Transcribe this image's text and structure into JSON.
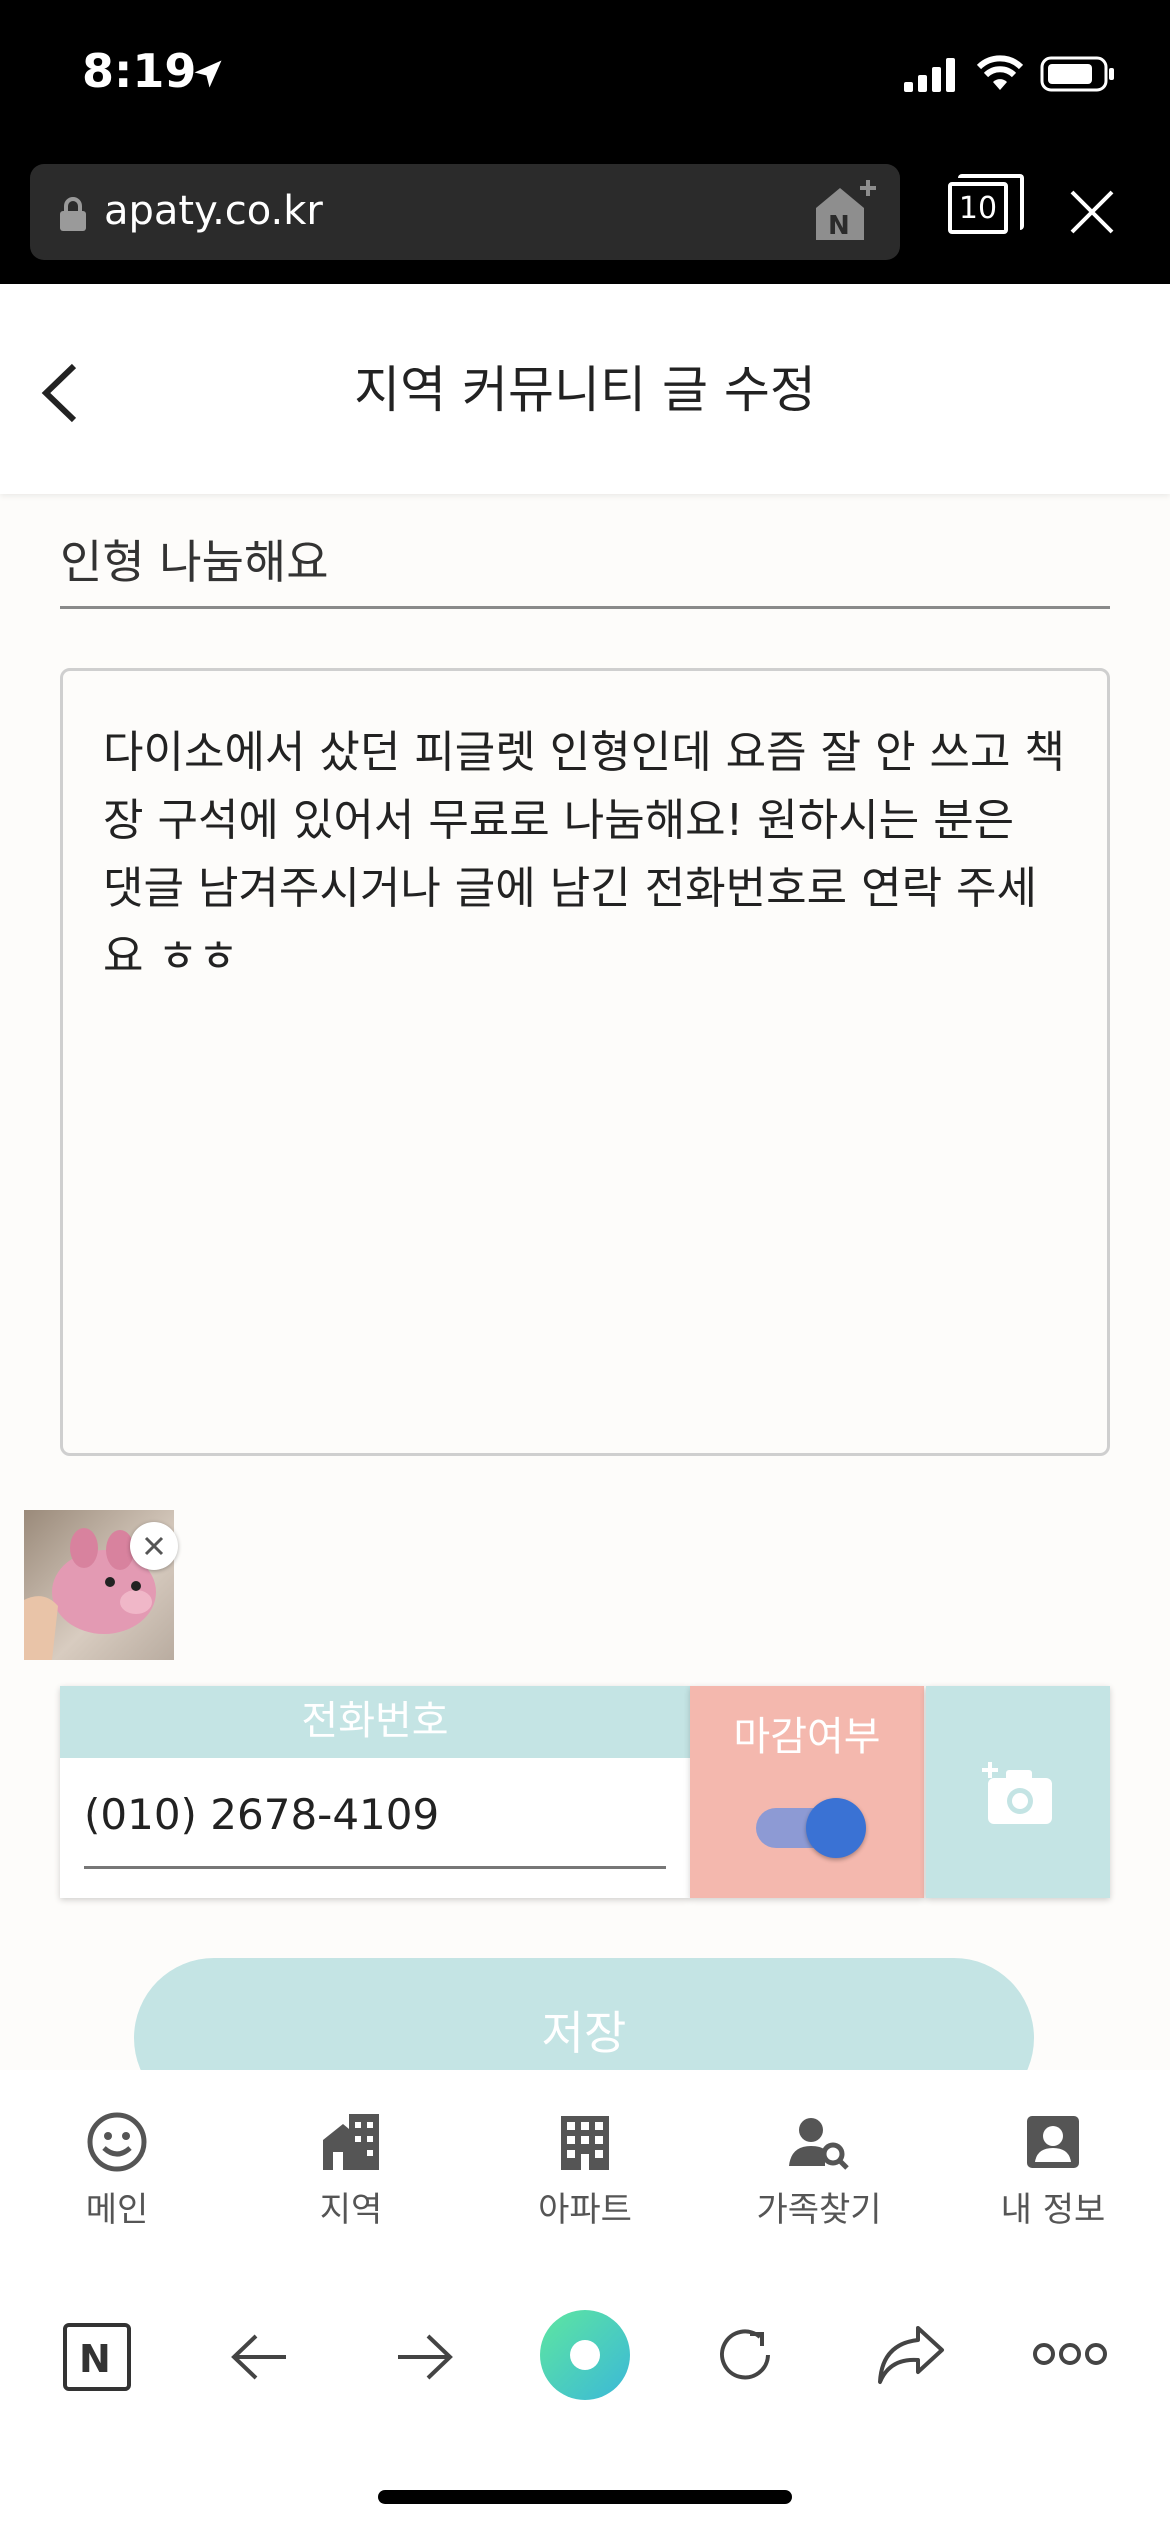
{
  "status": {
    "time": "8:19"
  },
  "browser": {
    "url": "apaty.co.kr",
    "tab_count": "10"
  },
  "header": {
    "title": "지역 커뮤니티 글 수정"
  },
  "post": {
    "title": "인형 나눔해요",
    "content": "다이소에서 샀던 피글렛 인형인데 요즘 잘 안 쓰고 책장 구석에 있어서 무료로 나눔해요! 원하시는 분은 댓글 남겨주시거나 글에 남긴 전화번호로 연락 주세요 ㅎㅎ"
  },
  "form": {
    "phone_label": "전화번호",
    "phone_value": "(010) 2678-4109",
    "closed_label": "마감여부",
    "closed_on": true,
    "save_label": "저장"
  },
  "nav": [
    {
      "label": "메인",
      "icon": "smiley-icon"
    },
    {
      "label": "지역",
      "icon": "region-house-icon"
    },
    {
      "label": "아파트",
      "icon": "apartment-icon"
    },
    {
      "label": "가족찾기",
      "icon": "family-search-icon"
    },
    {
      "label": "내 정보",
      "icon": "profile-icon"
    }
  ],
  "colors": {
    "mint": "#c4e4e4",
    "salmon": "#f4b8ae",
    "toggle_blue": "#3a72d4"
  }
}
